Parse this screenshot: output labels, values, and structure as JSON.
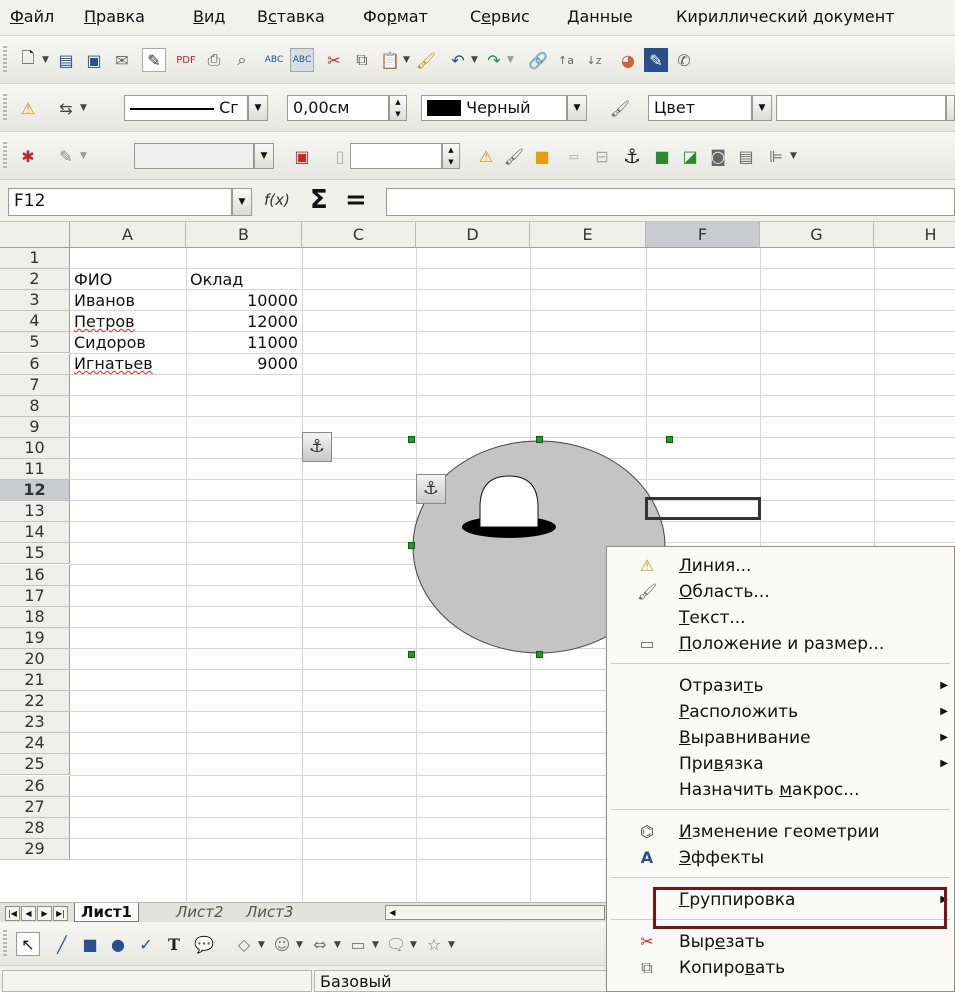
{
  "menubar": {
    "items": [
      {
        "pre": "",
        "u": "Ф",
        "post": "айл"
      },
      {
        "pre": "",
        "u": "П",
        "post": "равка"
      },
      {
        "pre": "",
        "u": "В",
        "post": "ид"
      },
      {
        "pre": "В",
        "u": "с",
        "post": "тавка"
      },
      {
        "pre": "Фо",
        "u": "р",
        "post": "мат"
      },
      {
        "pre": "С",
        "u": "е",
        "post": "рвис"
      },
      {
        "pre": "",
        "u": "Д",
        "post": "анные"
      },
      {
        "pre": "Кириллический документ",
        "u": "",
        "post": ""
      }
    ]
  },
  "lineprops": {
    "style_value": "Сг",
    "width_value": "0,00см",
    "color_value": "Черный",
    "area_style": "Цвет",
    "area_value": "",
    "color_swatch": "#000000"
  },
  "formula": {
    "name_box": "F12",
    "fx_icon": "f(x)",
    "sum_symbol": "Σ",
    "equals_symbol": "=",
    "content": ""
  },
  "grid": {
    "columns": [
      "A",
      "B",
      "C",
      "D",
      "E",
      "F",
      "G",
      "H"
    ],
    "active_column": "F",
    "active_row": "12",
    "rows": [
      "1",
      "2",
      "3",
      "4",
      "5",
      "6",
      "7",
      "8",
      "9",
      "10",
      "11",
      "12",
      "13",
      "14",
      "15",
      "16",
      "17",
      "18",
      "19",
      "20",
      "21",
      "22",
      "23",
      "24",
      "25",
      "26",
      "27",
      "28",
      "29"
    ],
    "cells": {
      "A2": "ФИО",
      "B2": "Оклад",
      "A3": "Иванов",
      "B3": "10000",
      "A4": "Петров",
      "B4": "12000",
      "A5": "Сидоров",
      "B5": "11000",
      "A6": "Игнатьев",
      "B6": "9000"
    }
  },
  "sheets": {
    "tabs": [
      "Лист1",
      "Лист2",
      "Лист3"
    ],
    "active": "Лист1"
  },
  "status": {
    "page_style": "Базовый"
  },
  "context_menu": {
    "items": [
      {
        "pre": "",
        "u": "Л",
        "post": "иния...",
        "icon": "line-icon"
      },
      {
        "pre": "",
        "u": "О",
        "post": "бласть...",
        "icon": "area-icon"
      },
      {
        "pre": "",
        "u": "Т",
        "post": "екст...",
        "icon": ""
      },
      {
        "pre": "",
        "u": "П",
        "post": "оложение и размер...",
        "icon": "position-size-icon"
      },
      {
        "pre": "Отрази",
        "u": "т",
        "post": "ь",
        "icon": "",
        "submenu": true
      },
      {
        "pre": "",
        "u": "Р",
        "post": "асположить",
        "icon": "",
        "submenu": true
      },
      {
        "pre": "",
        "u": "В",
        "post": "ыравнивание",
        "icon": "",
        "submenu": true
      },
      {
        "pre": "При",
        "u": "в",
        "post": "язка",
        "icon": "",
        "submenu": true
      },
      {
        "pre": "Назначить ",
        "u": "м",
        "post": "акрос...",
        "icon": ""
      },
      {
        "pre": "",
        "u": "И",
        "post": "зменение геометрии",
        "icon": "edit-points-icon"
      },
      {
        "pre": "",
        "u": "Э",
        "post": "ффекты",
        "icon": "fontwork-icon"
      },
      {
        "pre": "",
        "u": "Г",
        "post": "руппировка",
        "icon": "",
        "submenu": true
      },
      {
        "pre": "Выр",
        "u": "е",
        "post": "зать",
        "icon": "cut-icon"
      },
      {
        "pre": "Копиро",
        "u": "в",
        "post": "ать",
        "icon": "copy-icon"
      }
    ]
  }
}
